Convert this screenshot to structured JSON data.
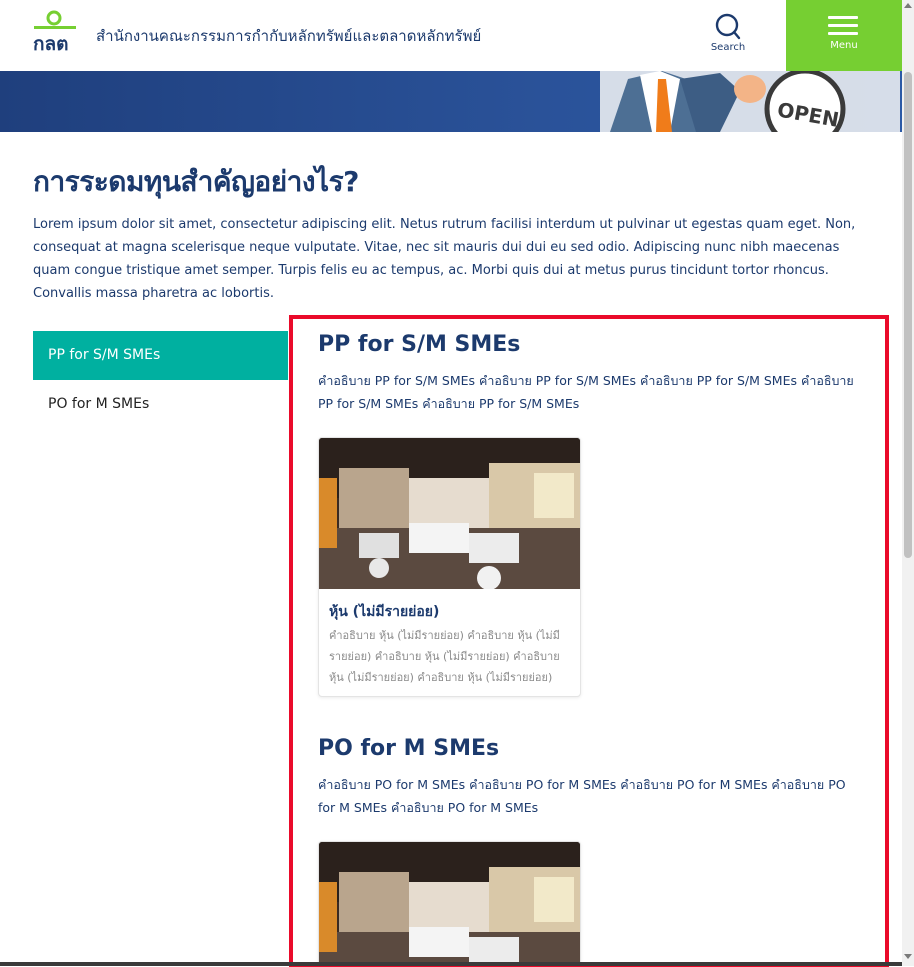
{
  "header": {
    "site_title": "สำนักงานคณะกรรมการกำกับหลักทรัพย์และตลาดหลักทรัพย์",
    "search_label": "Search",
    "menu_label": "Menu",
    "logo_text": "กลต"
  },
  "colors": {
    "brand_navy": "#1c3a6d",
    "menu_green": "#76cf32",
    "active_teal": "#00b0a0",
    "highlight_red": "#ea0a2a"
  },
  "hero": {
    "sign_text": "OPEN"
  },
  "main": {
    "title": "การระดมทุนสำคัญอย่างไร?",
    "intro": "Lorem ipsum dolor sit amet, consectetur adipiscing elit. Netus rutrum facilisi interdum ut pulvinar ut egestas quam eget. Non, consequat at magna scelerisque neque vulputate. Vitae, nec sit mauris dui dui eu sed odio. Adipiscing nunc nibh maecenas quam congue tristique amet semper. Turpis felis eu ac tempus, ac. Morbi quis dui at metus purus tincidunt tortor rhoncus. Convallis massa pharetra ac lobortis."
  },
  "sidebar": {
    "items": [
      {
        "label": "PP for S/M SMEs",
        "active": true
      },
      {
        "label": "PO for M SMEs",
        "active": false
      }
    ]
  },
  "sections": [
    {
      "title": "PP for S/M SMEs",
      "description": "คำอธิบาย PP for S/M SMEs คำอธิบาย PP for S/M SMEs คำอธิบาย PP for S/M SMEs คำอธิบาย PP for S/M SMEs คำอธิบาย PP for S/M SMEs",
      "card": {
        "title": "หุ้น (ไม่มีรายย่อย)",
        "description": "คำอธิบาย หุ้น (ไม่มีรายย่อย) คำอธิบาย หุ้น (ไม่มีรายย่อย) คำอธิบาย หุ้น (ไม่มีรายย่อย) คำอธิบาย หุ้น (ไม่มีรายย่อย) คำอธิบาย หุ้น (ไม่มีรายย่อย)"
      }
    },
    {
      "title": "PO for M SMEs",
      "description": "คำอธิบาย PO for M SMEs คำอธิบาย PO for M SMEs คำอธิบาย PO for M SMEs คำอธิบาย PO for M SMEs คำอธิบาย PO for M SMEs"
    }
  ]
}
